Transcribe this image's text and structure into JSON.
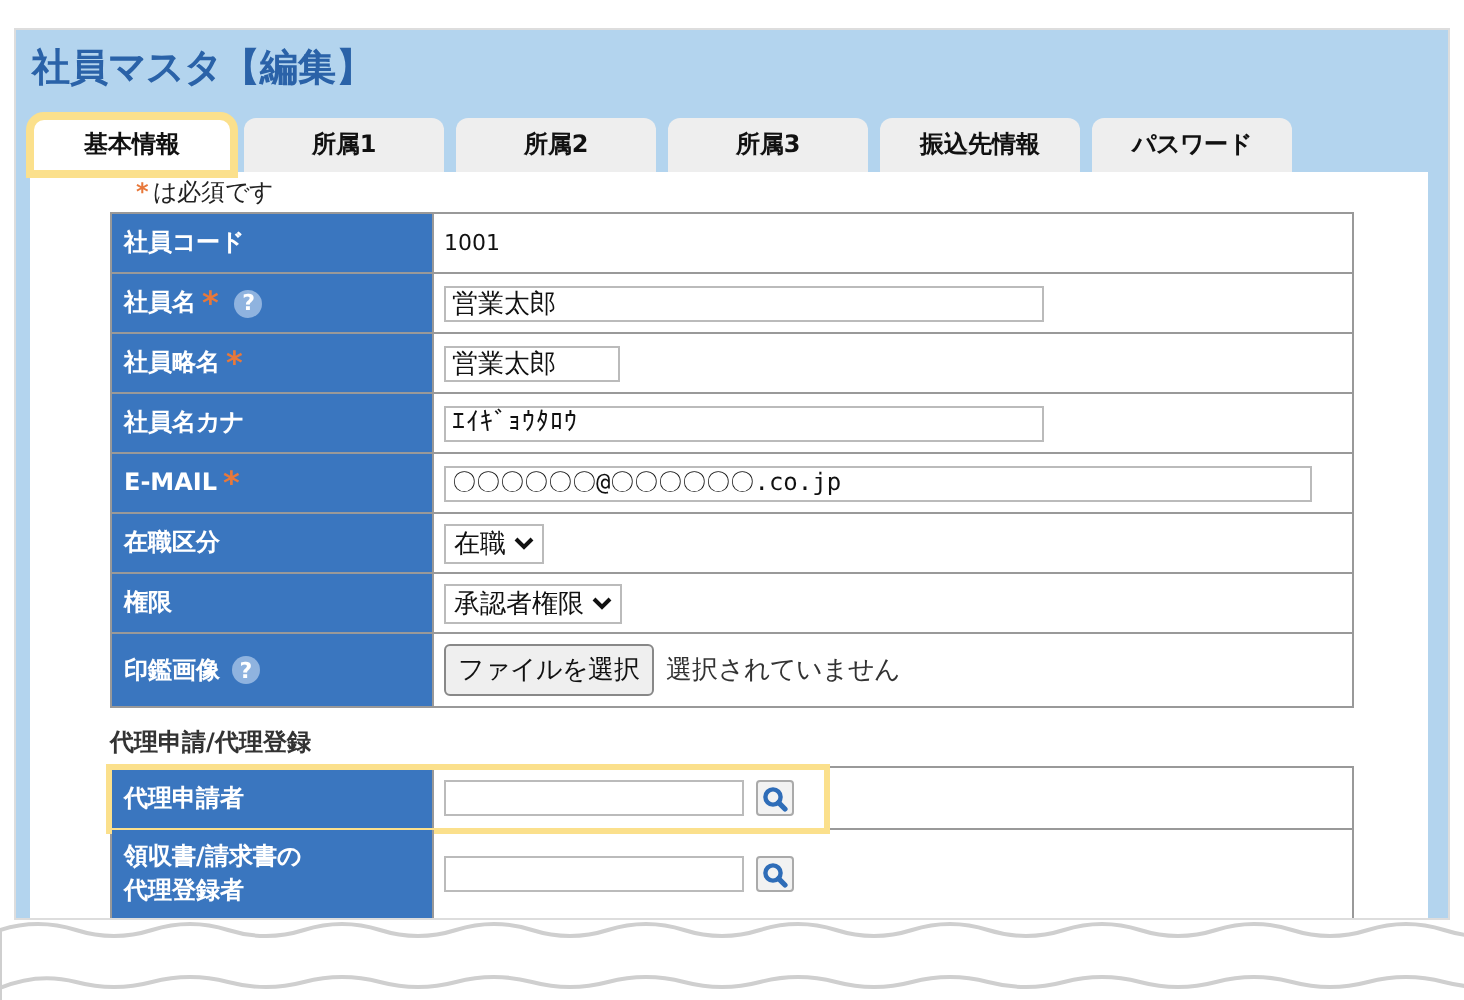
{
  "title": "社員マスタ【編集】",
  "tabs": [
    {
      "label": "基本情報",
      "selected": true,
      "highlighted": true
    },
    {
      "label": "所属1",
      "selected": false,
      "highlighted": false
    },
    {
      "label": "所属2",
      "selected": false,
      "highlighted": false
    },
    {
      "label": "所属3",
      "selected": false,
      "highlighted": false
    },
    {
      "label": "振込先情報",
      "selected": false,
      "highlighted": false
    },
    {
      "label": "パスワード",
      "selected": false,
      "highlighted": false
    }
  ],
  "note": {
    "mark": "*",
    "text": "は必須です"
  },
  "fields": [
    {
      "label": "社員コード",
      "kind": "text",
      "value": "1001"
    },
    {
      "label": "社員名",
      "mark": "*",
      "help": "?",
      "kind": "input",
      "value": "営業太郎"
    },
    {
      "label": "社員略名",
      "mark": "*",
      "kind": "input",
      "value": "営業太郎"
    },
    {
      "label": "社員名カナ",
      "kind": "input",
      "value": "ｴｲｷﾞｮｳﾀﾛｳ"
    },
    {
      "label": "E-MAIL",
      "mark": "*",
      "kind": "input",
      "value": "〇〇〇〇〇〇@〇〇〇〇〇〇.co.jp"
    },
    {
      "label": "在職区分",
      "kind": "select",
      "value": "在職"
    },
    {
      "label": "権限",
      "kind": "select",
      "value": "承認者権限"
    },
    {
      "label": "印鑑画像",
      "help": "?",
      "kind": "file",
      "button": "ファイルを選択",
      "status": "選択されていません"
    }
  ],
  "proxy": {
    "heading": "代理申請/代理登録",
    "rows": [
      {
        "lines": [
          "代理申請者"
        ],
        "kind": "search",
        "highlighted": true
      },
      {
        "lines": [
          "領収書/請求書の",
          "代理登録者"
        ],
        "kind": "search",
        "highlighted": false
      }
    ]
  }
}
